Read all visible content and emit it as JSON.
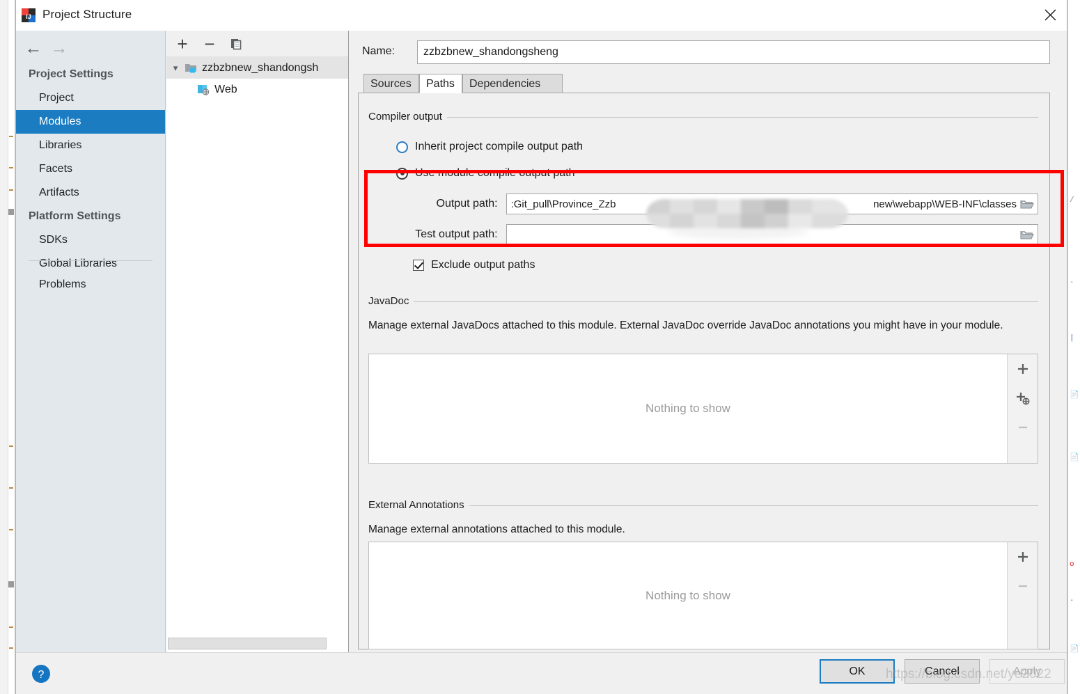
{
  "window": {
    "title": "Project Structure",
    "app_icon": "intellij-idea-icon",
    "close_icon": "close-icon"
  },
  "nav": {
    "back_icon": "arrow-left-icon",
    "forward_icon": "arrow-right-icon"
  },
  "sidebar": {
    "groups": [
      {
        "label": "Project Settings",
        "items": [
          {
            "label": "Project",
            "selected": false
          },
          {
            "label": "Modules",
            "selected": true
          },
          {
            "label": "Libraries",
            "selected": false
          },
          {
            "label": "Facets",
            "selected": false
          },
          {
            "label": "Artifacts",
            "selected": false
          }
        ]
      },
      {
        "label": "Platform Settings",
        "items": [
          {
            "label": "SDKs",
            "selected": false
          },
          {
            "label": "Global Libraries",
            "selected": false
          }
        ]
      }
    ],
    "extra_items": [
      {
        "label": "Problems",
        "selected": false
      }
    ]
  },
  "tree_toolbar": {
    "add_label": "+",
    "remove_label": "−",
    "copy_icon": "copy-icon"
  },
  "tree": {
    "rows": [
      {
        "label": "zzbzbnew_shandongsh",
        "icon": "module-folder-icon",
        "expanded": true,
        "selected": true,
        "indent": 0
      },
      {
        "label": "Web",
        "icon": "web-facet-icon",
        "expanded": false,
        "selected": false,
        "indent": 1
      }
    ],
    "expand_arrow": "chevron-down-icon"
  },
  "module": {
    "name_label": "Name:",
    "name_value": "zzbzbnew_shandongsheng",
    "tabs": [
      {
        "label": "Sources",
        "active": false
      },
      {
        "label": "Paths",
        "active": true
      },
      {
        "label": "Dependencies",
        "active": false
      }
    ]
  },
  "compiler_output": {
    "group_title": "Compiler output",
    "inherit_label": "Inherit project compile output path",
    "inherit_selected": false,
    "module_label": "Use module compile output path",
    "module_selected": true,
    "output_path_label": "Output path:",
    "output_path_value_prefix": ":Git_pull\\Province_Zzb",
    "output_path_value_suffix": "new\\webapp\\WEB-INF\\classes",
    "test_output_path_label": "Test output path:",
    "test_output_path_value": "",
    "exclude_label": "Exclude output paths",
    "exclude_checked": true,
    "browse_icon": "folder-browse-icon",
    "highlight_color": "#ff0000"
  },
  "javadoc": {
    "group_title": "JavaDoc",
    "description": "Manage external JavaDocs attached to this module. External JavaDoc override JavaDoc annotations you might have in your module.",
    "empty_text": "Nothing to show",
    "buttons": [
      {
        "icon": "plus-icon",
        "label": "+",
        "enabled": true
      },
      {
        "icon": "plus-url-icon",
        "label": "+",
        "enabled": true
      },
      {
        "icon": "minus-icon",
        "label": "−",
        "enabled": false
      }
    ]
  },
  "external_annotations": {
    "group_title": "External Annotations",
    "description": "Manage external annotations attached to this module.",
    "empty_text": "Nothing to show",
    "buttons": [
      {
        "icon": "plus-icon",
        "label": "+",
        "enabled": true
      },
      {
        "icon": "minus-icon",
        "label": "−",
        "enabled": false
      }
    ]
  },
  "footer": {
    "help_icon": "help-question-icon",
    "ok_label": "OK",
    "cancel_label": "Cancel",
    "apply_label": "Apply"
  },
  "watermark": {
    "text": "https://blog.csdn.net/ye2022"
  },
  "colors": {
    "accent": "#1b7cc2",
    "sidebar_bg": "#e3e8ec",
    "panel_bg": "#f0f0f0",
    "highlight": "#ff0000"
  }
}
